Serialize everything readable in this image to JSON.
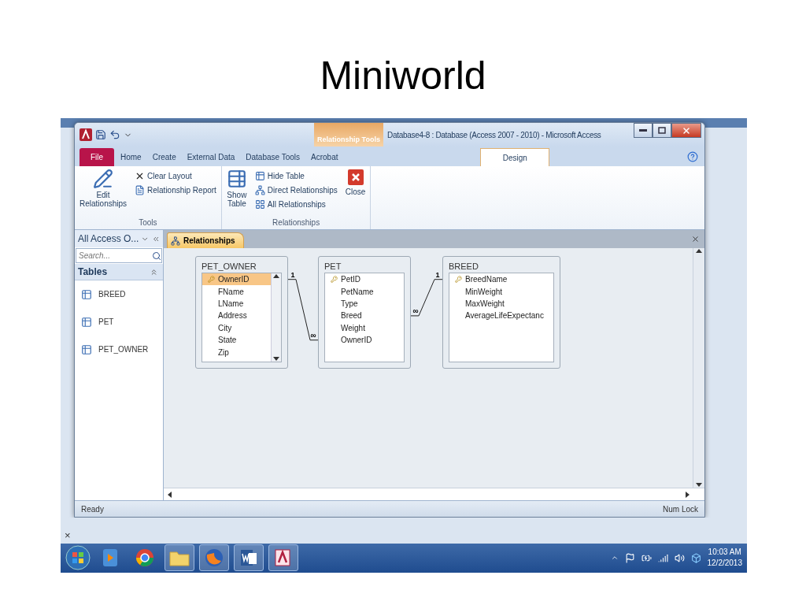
{
  "slide": {
    "title": "Miniworld"
  },
  "window": {
    "title": "Database4-8 : Database (Access 2007 - 2010) - Microsoft Access",
    "contextual_tab": "Relationship Tools"
  },
  "ribbon_tabs": [
    {
      "label": "File",
      "kind": "file",
      "selected": false
    },
    {
      "label": "Home",
      "kind": "tab",
      "selected": false
    },
    {
      "label": "Create",
      "kind": "tab",
      "selected": false
    },
    {
      "label": "External Data",
      "kind": "tab",
      "selected": false
    },
    {
      "label": "Database Tools",
      "kind": "tab",
      "selected": false
    },
    {
      "label": "Acrobat",
      "kind": "tab",
      "selected": false
    },
    {
      "label": "Design",
      "kind": "contextual",
      "selected": true
    }
  ],
  "ribbon_groups": [
    {
      "label": "Tools",
      "items": [
        {
          "label": "Edit Relationships",
          "kind": "large"
        },
        {
          "label": "Clear Layout",
          "kind": "small"
        },
        {
          "label": "Relationship Report",
          "kind": "small"
        }
      ]
    },
    {
      "label": "Relationships",
      "items": [
        {
          "label": "Show Table",
          "kind": "large"
        },
        {
          "label": "Hide Table",
          "kind": "small"
        },
        {
          "label": "Direct Relationships",
          "kind": "small"
        },
        {
          "label": "All Relationships",
          "kind": "small"
        },
        {
          "label": "Close",
          "kind": "large"
        }
      ]
    }
  ],
  "nav": {
    "title": "All Access O...",
    "search": {
      "placeholder": "Search..."
    },
    "section": "Tables",
    "items": [
      {
        "label": "BREED"
      },
      {
        "label": "PET"
      },
      {
        "label": "PET_OWNER"
      }
    ]
  },
  "document_tab": {
    "label": "Relationships"
  },
  "tables": [
    {
      "name": "PET_OWNER",
      "scrollable": true,
      "fields": [
        {
          "name": "OwnerID",
          "key": true,
          "selected": true
        },
        {
          "name": "FName",
          "key": false,
          "selected": false
        },
        {
          "name": "LName",
          "key": false,
          "selected": false
        },
        {
          "name": "Address",
          "key": false,
          "selected": false
        },
        {
          "name": "City",
          "key": false,
          "selected": false
        },
        {
          "name": "State",
          "key": false,
          "selected": false
        },
        {
          "name": "Zip",
          "key": false,
          "selected": false
        }
      ]
    },
    {
      "name": "PET",
      "scrollable": false,
      "fields": [
        {
          "name": "PetID",
          "key": true,
          "selected": false
        },
        {
          "name": "PetName",
          "key": false,
          "selected": false
        },
        {
          "name": "Type",
          "key": false,
          "selected": false
        },
        {
          "name": "Breed",
          "key": false,
          "selected": false
        },
        {
          "name": "Weight",
          "key": false,
          "selected": false
        },
        {
          "name": "OwnerID",
          "key": false,
          "selected": false
        }
      ]
    },
    {
      "name": "BREED",
      "scrollable": false,
      "fields": [
        {
          "name": "BreedName",
          "key": true,
          "selected": false
        },
        {
          "name": "MinWeight",
          "key": false,
          "selected": false
        },
        {
          "name": "MaxWeight",
          "key": false,
          "selected": false
        },
        {
          "name": "AverageLifeExpectanc",
          "key": false,
          "selected": false
        }
      ]
    }
  ],
  "relationships": [
    {
      "from_label": "1",
      "to_label": "∞"
    },
    {
      "from_label": "1",
      "to_label": "∞"
    }
  ],
  "status_bar": {
    "left": "Ready",
    "right": "Num Lock"
  },
  "browser_bar": {
    "close": "×"
  },
  "taskbar": {
    "time": "10:03 AM",
    "date": "12/2/2013"
  }
}
